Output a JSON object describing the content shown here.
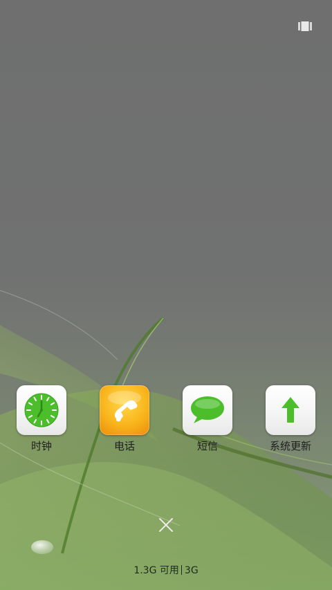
{
  "recents": {
    "icon": "recents-icon",
    "apps": [
      {
        "label": "时钟",
        "icon": "clock-icon"
      },
      {
        "label": "电话",
        "icon": "phone-icon"
      },
      {
        "label": "短信",
        "icon": "message-icon"
      },
      {
        "label": "系统更新",
        "icon": "system-update-icon"
      }
    ],
    "close_icon": "close-icon",
    "memory": {
      "available": "1.3G 可用",
      "total": "3G"
    }
  },
  "colors": {
    "icon_green": "#4cbe2c",
    "phone_orange": "#f7ac1a",
    "overlay_gray": "#6f7170",
    "label_text": "#1f1f1f"
  }
}
